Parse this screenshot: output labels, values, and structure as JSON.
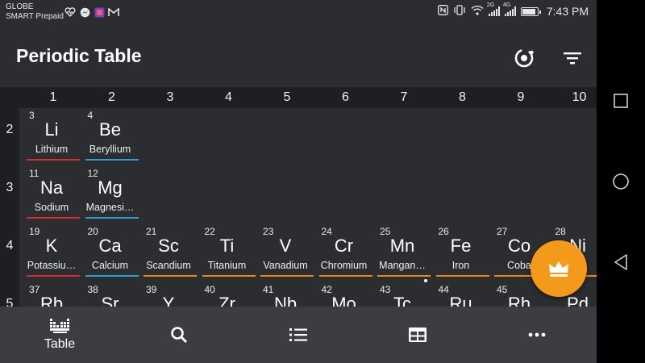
{
  "status_bar": {
    "carrier_line1": "GLOBE",
    "carrier_line2": "SMART Prepaid",
    "network_a": "2G",
    "network_b": "4G",
    "time": "7:43 PM",
    "left_icons": [
      "heart-rate-icon",
      "messenger-icon",
      "app-icon",
      "gmail-icon"
    ],
    "right_icons": [
      "nfc-icon",
      "vibrate-icon",
      "wifi-icon",
      "signal-icon",
      "signal-icon",
      "battery-icon"
    ]
  },
  "app_bar": {
    "title": "Periodic Table",
    "actions": [
      "atom-icon",
      "filter-icon"
    ]
  },
  "table": {
    "columns": [
      "1",
      "2",
      "3",
      "4",
      "5",
      "6",
      "7",
      "8",
      "9",
      "10"
    ],
    "rows": [
      "2",
      "3",
      "4",
      "5"
    ],
    "elements": [
      {
        "number": "3",
        "symbol": "Li",
        "name": "Lithium",
        "group": "alkali"
      },
      {
        "number": "4",
        "symbol": "Be",
        "name": "Beryllium",
        "group": "alkaline"
      },
      {
        "number": "11",
        "symbol": "Na",
        "name": "Sodium",
        "group": "alkali"
      },
      {
        "number": "12",
        "symbol": "Mg",
        "name": "Magnesi…",
        "group": "alkaline"
      },
      {
        "number": "19",
        "symbol": "K",
        "name": "Potassiu…",
        "group": "alkali"
      },
      {
        "number": "20",
        "symbol": "Ca",
        "name": "Calcium",
        "group": "alkaline"
      },
      {
        "number": "21",
        "symbol": "Sc",
        "name": "Scandium",
        "group": "transition"
      },
      {
        "number": "22",
        "symbol": "Ti",
        "name": "Titanium",
        "group": "transition"
      },
      {
        "number": "23",
        "symbol": "V",
        "name": "Vanadium",
        "group": "transition"
      },
      {
        "number": "24",
        "symbol": "Cr",
        "name": "Chromium",
        "group": "transition"
      },
      {
        "number": "25",
        "symbol": "Mn",
        "name": "Mangan…",
        "group": "transition"
      },
      {
        "number": "26",
        "symbol": "Fe",
        "name": "Iron",
        "group": "transition"
      },
      {
        "number": "27",
        "symbol": "Co",
        "name": "Coba",
        "group": "transition"
      },
      {
        "number": "28",
        "symbol": "Ni",
        "name": "el",
        "group": "transition"
      },
      {
        "number": "37",
        "symbol": "Rb",
        "name": "",
        "group": "alkali"
      },
      {
        "number": "38",
        "symbol": "Sr",
        "name": "",
        "group": "alkaline"
      },
      {
        "number": "39",
        "symbol": "Y",
        "name": "",
        "group": "transition"
      },
      {
        "number": "40",
        "symbol": "Zr",
        "name": "",
        "group": "transition"
      },
      {
        "number": "41",
        "symbol": "Nb",
        "name": "",
        "group": "transition"
      },
      {
        "number": "42",
        "symbol": "Mo",
        "name": "",
        "group": "transition"
      },
      {
        "number": "43",
        "symbol": "Tc",
        "name": "",
        "group": "transition"
      },
      {
        "number": "44",
        "symbol": "Ru",
        "name": "",
        "group": "transition"
      },
      {
        "number": "45",
        "symbol": "Rh",
        "name": "",
        "group": "transition"
      },
      {
        "number": "",
        "symbol": "Pd",
        "name": "",
        "group": "transition"
      }
    ],
    "group_colors": {
      "alkali": "#d32f2f",
      "alkaline": "#29a3d6",
      "transition": "#e8891c"
    }
  },
  "fab": {
    "icon": "crown-icon",
    "color": "#f49a1a"
  },
  "bottom_nav": {
    "items": [
      {
        "icon": "periodic-table-icon",
        "label": "Table"
      },
      {
        "icon": "search-icon",
        "label": ""
      },
      {
        "icon": "list-icon",
        "label": ""
      },
      {
        "icon": "grid-icon",
        "label": ""
      },
      {
        "icon": "more-icon",
        "label": ""
      }
    ]
  },
  "system_nav": [
    "recents-icon",
    "home-icon",
    "back-icon"
  ]
}
